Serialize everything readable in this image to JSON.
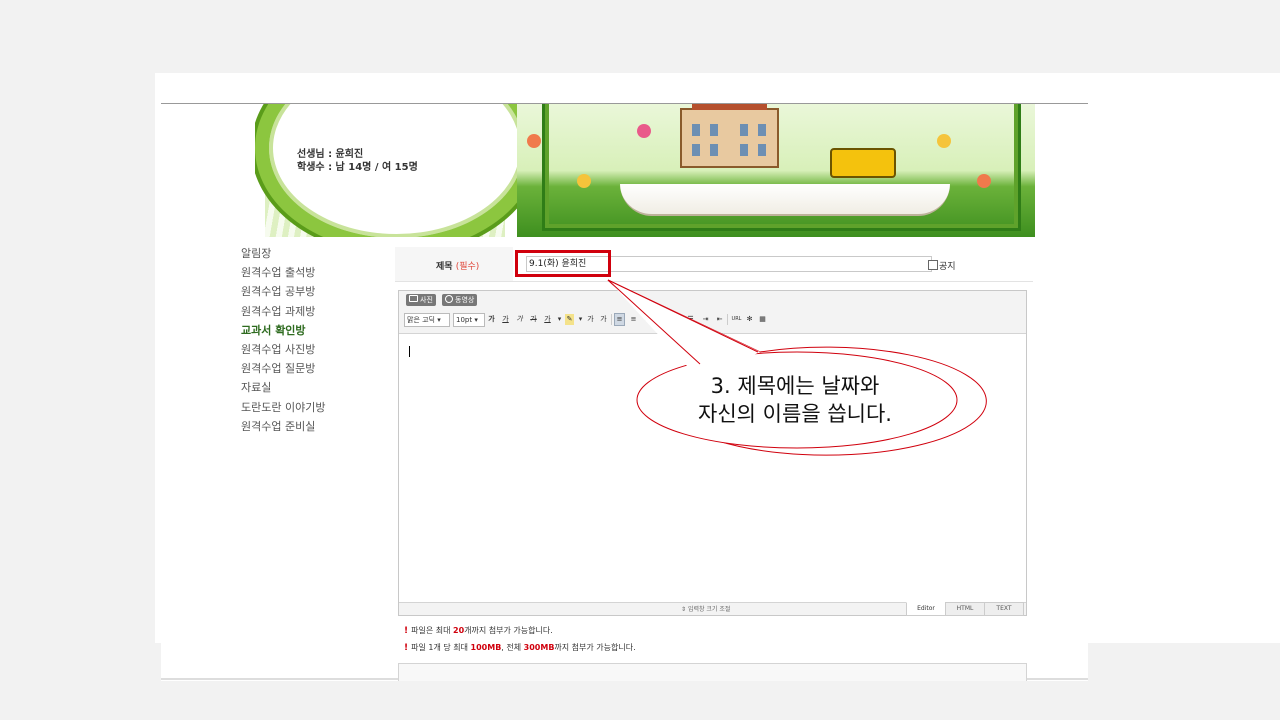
{
  "banner": {
    "teacher_line": "선생님 : 윤희진",
    "students_line": "학생수 : 남 14명 / 여 15명"
  },
  "menu": {
    "items": [
      {
        "label": "알림장"
      },
      {
        "label": "원격수업 출석방"
      },
      {
        "label": "원격수업 공부방"
      },
      {
        "label": "원격수업 과제방"
      },
      {
        "label": "교과서 확인방",
        "active": true
      },
      {
        "label": "원격수업 사진방"
      },
      {
        "label": "원격수업 질문방"
      },
      {
        "label": "자료실"
      },
      {
        "label": "도란도란 이야기방"
      },
      {
        "label": "원격수업 준비실"
      }
    ]
  },
  "form": {
    "title_label": "제목",
    "title_required": "(필수)",
    "title_value": "9.1(화) 윤희진",
    "notice_label": "공지",
    "highlight_color": "#d0000d"
  },
  "editor": {
    "photo_button": "사진",
    "video_button": "동영상",
    "font_select": "맑은 고딕",
    "size_select": "10pt",
    "resize_label": "입력창 크기 조절",
    "tabs": [
      "Editor",
      "HTML",
      "TEXT"
    ],
    "active_tab": "Editor",
    "tools": {
      "bold": "가",
      "underline": "가",
      "italic": "가",
      "strike": "가",
      "font_color": "가",
      "superscript": "가",
      "subscript": "가",
      "url": "URL"
    }
  },
  "attachment_info": {
    "line1_prefix": "파일은 최대 ",
    "line1_count": "20",
    "line1_suffix": "개까지 첨부가 가능합니다.",
    "line2_prefix": "파일 1개 당 최대 ",
    "line2_per_file": "100MB",
    "line2_mid": ", 전체 ",
    "line2_total": "300MB",
    "line2_suffix": "까지 첨부가 가능합니다.",
    "mark": "!"
  },
  "callout": {
    "line1": "3.  제목에는  날짜와",
    "line2": "자신의  이름을  씁니다."
  }
}
